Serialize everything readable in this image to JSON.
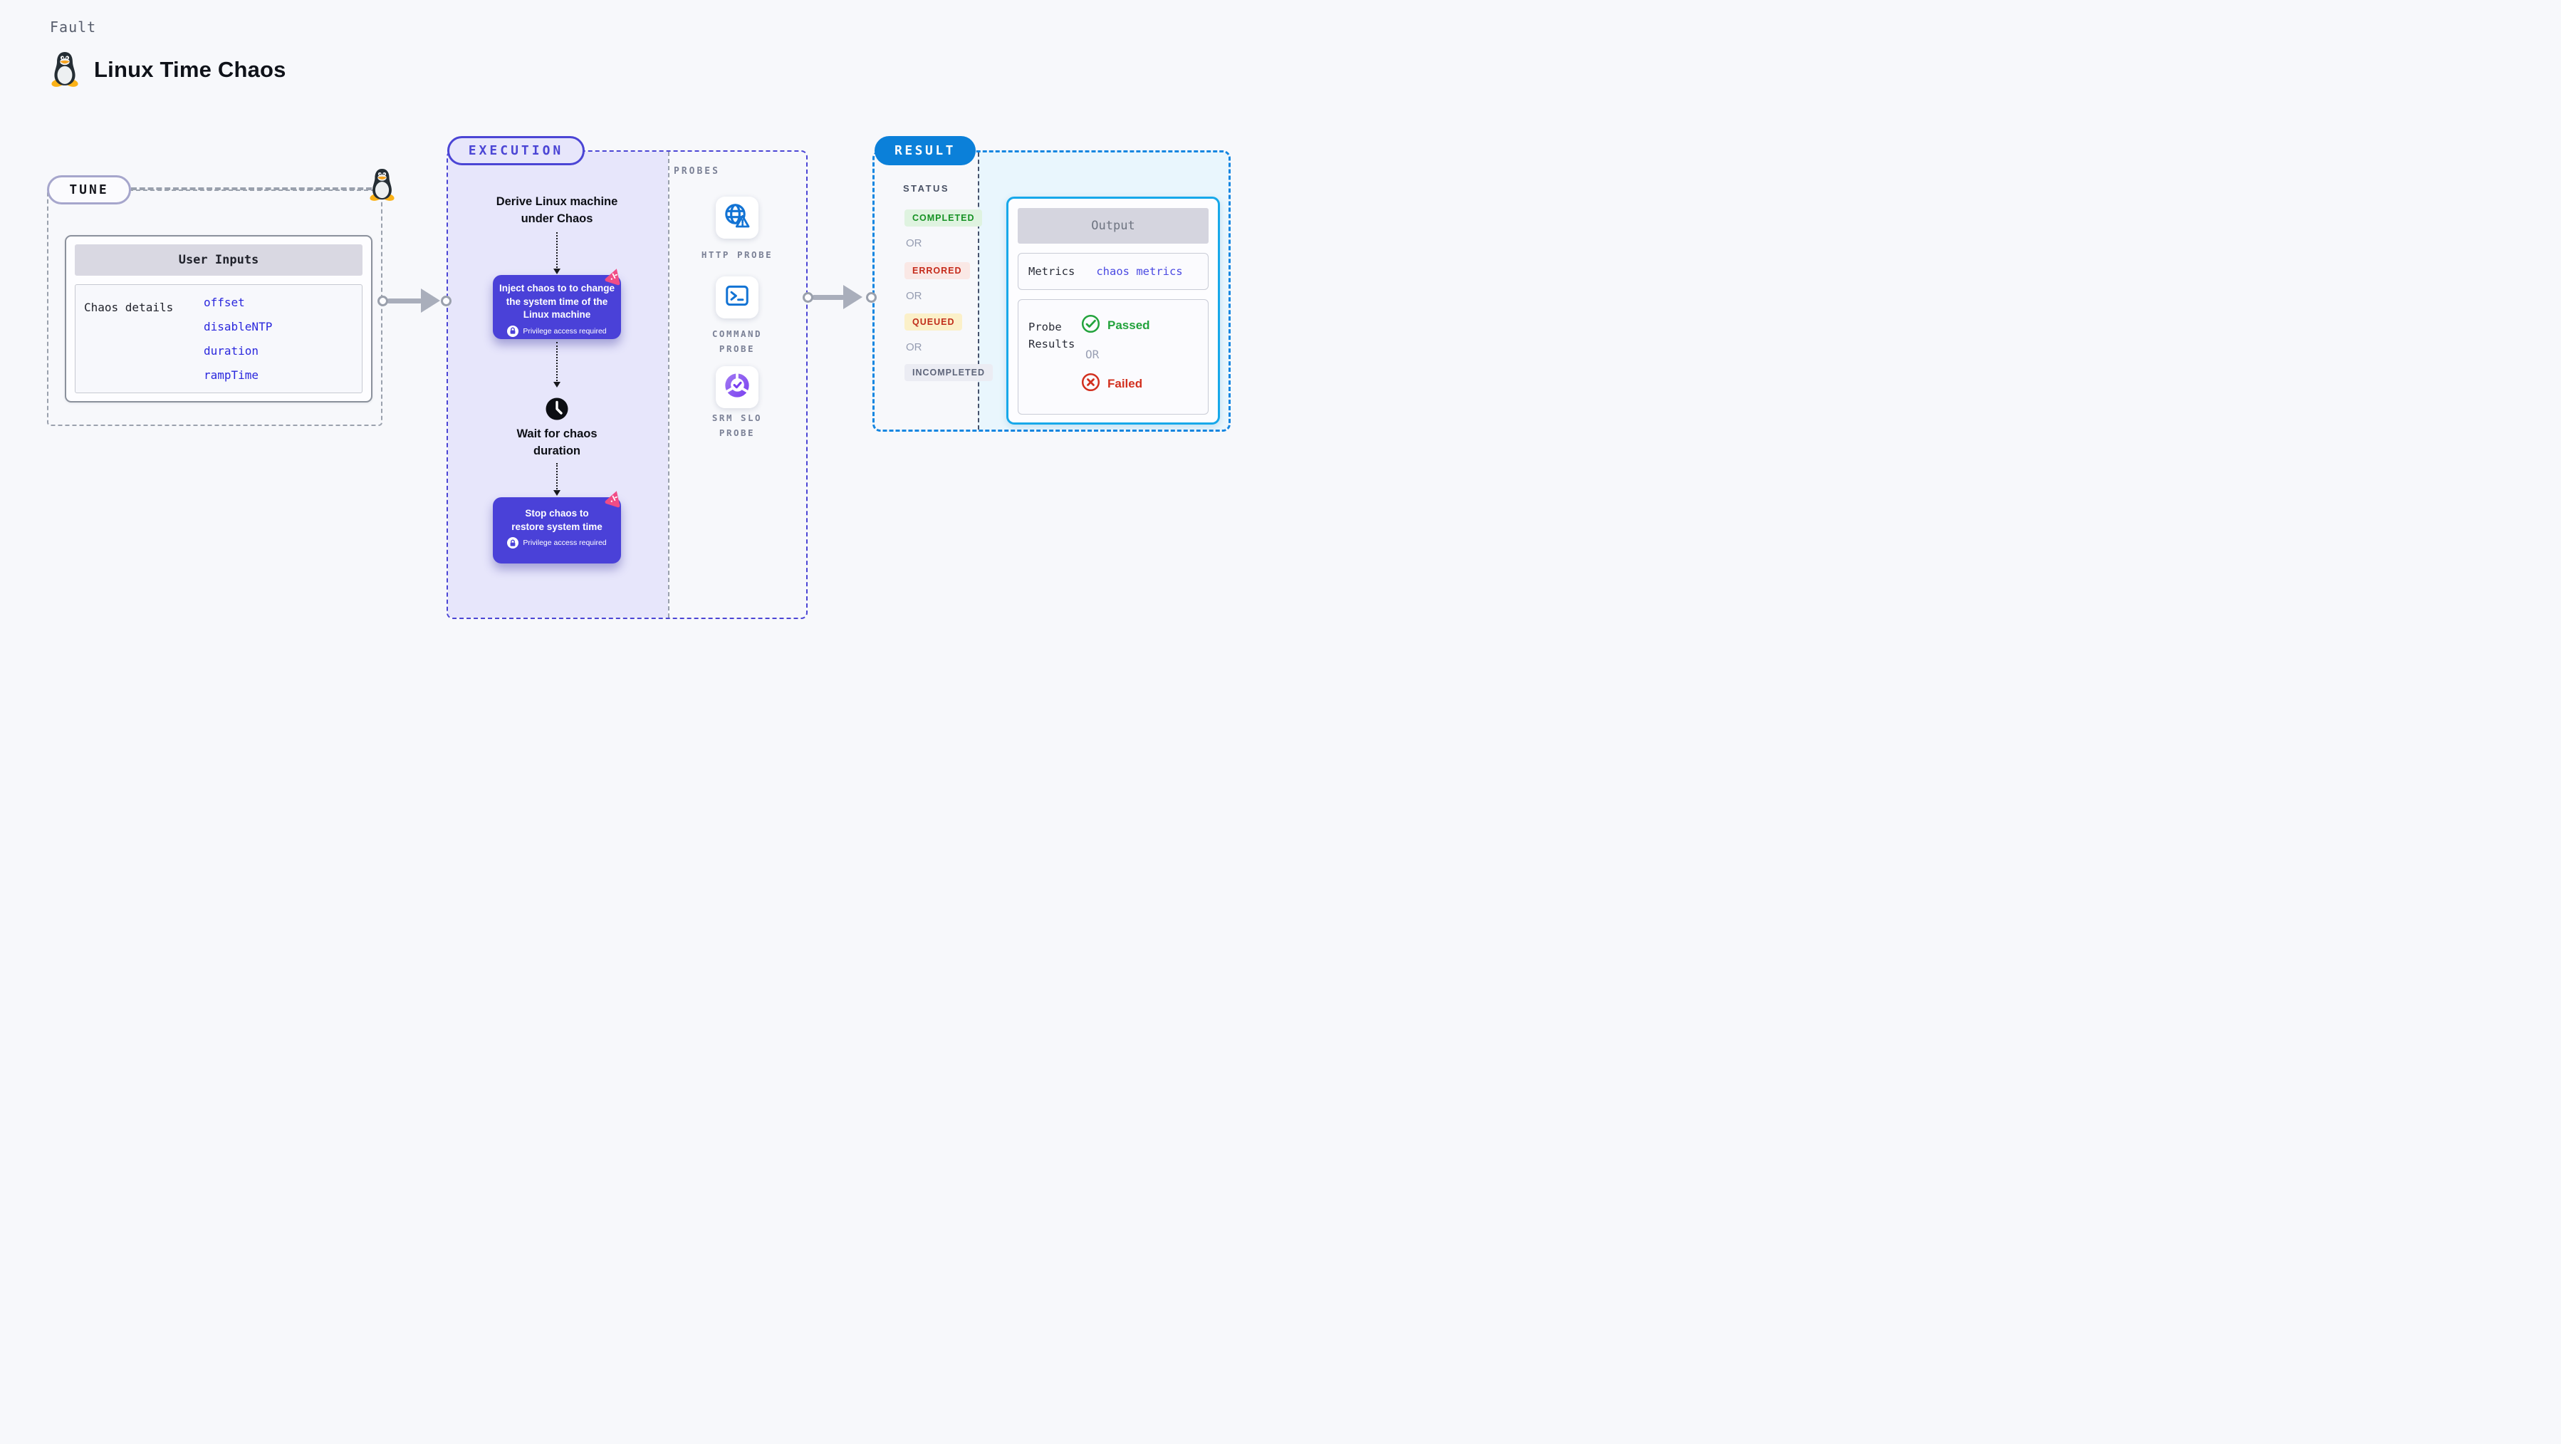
{
  "header": {
    "kicker": "Fault",
    "title": "Linux Time Chaos"
  },
  "tune": {
    "label": "TUNE",
    "user_inputs": {
      "title": "User Inputs",
      "row_label": "Chaos details",
      "values": [
        "offset",
        "disableNTP",
        "duration",
        "rampTime"
      ]
    }
  },
  "execution": {
    "label": "EXECUTION",
    "derive_step": "Derive Linux machine\nunder Chaos",
    "inject_step": "Inject chaos to to change\nthe system time of the\nLinux machine",
    "privilege_note": "Privilege access required",
    "wait_step": "Wait for chaos\nduration",
    "stop_step": "Stop chaos to\nrestore system time"
  },
  "probes": {
    "label": "PROBES",
    "items": [
      {
        "label": "HTTP PROBE",
        "icon": "globe-alert-icon"
      },
      {
        "label": "COMMAND\nPROBE",
        "icon": "terminal-icon"
      },
      {
        "label": "SRM SLO\nPROBE",
        "icon": "slo-pie-icon"
      }
    ]
  },
  "result": {
    "label": "RESULT",
    "status": {
      "title": "STATUS",
      "separator": "OR",
      "badges": [
        "COMPLETED",
        "ERRORED",
        "QUEUED",
        "INCOMPLETED"
      ]
    },
    "output": {
      "title": "Output",
      "metrics_label": "Metrics",
      "metrics_value": "chaos metrics",
      "probe_results_label": "Probe\nResults",
      "passed": "Passed",
      "separator": "OR",
      "failed": "Failed"
    }
  },
  "colors": {
    "accent_indigo": "#4b45d5",
    "chaos_card_purple": "#4a41d8",
    "result_blue": "#0b80d9",
    "output_border_cyan": "#17a8ea",
    "value_link_blue": "#2b28dd",
    "metrics_value_blue": "#4a49e2",
    "success_green": "#23a33c",
    "error_red": "#d2301f",
    "completed_bg": "#dff3e0",
    "errored_bg": "#fae8e5",
    "queued_bg": "#fbf0c9",
    "incompleted_bg": "#ebecf3",
    "pink_logo": "#f14c86",
    "probe_icon_blue": "#1273d4"
  }
}
